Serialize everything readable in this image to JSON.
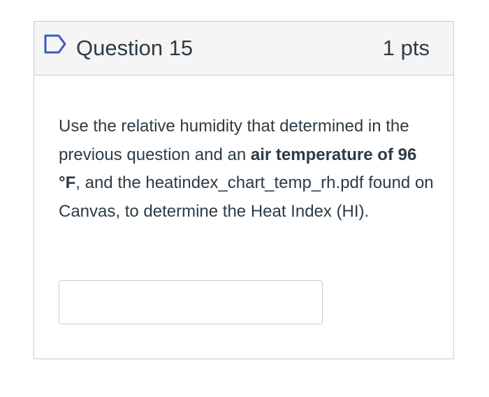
{
  "question": {
    "title": "Question 15",
    "points": "1 pts",
    "flag_icon": "flag-outline-icon",
    "text_parts": {
      "p1": "Use the relative humidity that determined in the previous question and an ",
      "bold1": "air temperature of 96 °F",
      "p2": ", and the heatindex_chart_temp_rh.pdf found on Canvas, to determine the Heat Index (HI)."
    },
    "answer": {
      "value": "",
      "placeholder": ""
    }
  },
  "colors": {
    "header_bg": "#f5f5f5",
    "border": "#c7cdd1",
    "text": "#2d3b45",
    "flag_stroke": "#3b5bbd"
  }
}
